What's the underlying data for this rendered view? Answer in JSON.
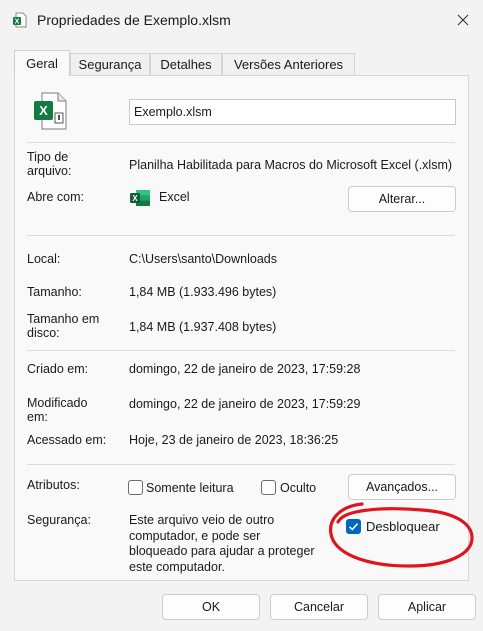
{
  "window": {
    "title": "Propriedades de Exemplo.xlsm",
    "close_icon": "close-icon"
  },
  "tabs": [
    {
      "label": "Geral",
      "active": true
    },
    {
      "label": "Segurança",
      "active": false
    },
    {
      "label": "Detalhes",
      "active": false
    },
    {
      "label": "Versões Anteriores",
      "active": false
    }
  ],
  "general": {
    "file_icon": "excel-macro-file-icon",
    "filename": "Exemplo.xlsm",
    "type_label": "Tipo de\narquivo:",
    "type_value": "Planilha Habilitada para Macros do Microsoft Excel (.xlsm)",
    "opens_with_label": "Abre com:",
    "opens_with_app": "Excel",
    "change_button": "Alterar...",
    "location_label": "Local:",
    "location_value": "C:\\Users\\santo\\Downloads",
    "size_label": "Tamanho:",
    "size_value": "1,84 MB (1.933.496 bytes)",
    "size_on_disk_label": "Tamanho em\ndisco:",
    "size_on_disk_value": "1,84 MB (1.937.408 bytes)",
    "created_label": "Criado em:",
    "created_value": "domingo, 22 de janeiro de 2023, 17:59:28",
    "modified_label": "Modificado\nem:",
    "modified_value": "domingo, 22 de janeiro de 2023, 17:59:29",
    "accessed_label": "Acessado em:",
    "accessed_value": "Hoje, 23 de janeiro de 2023, 18:36:25",
    "attributes_label": "Atributos:",
    "readonly_label": "Somente leitura",
    "readonly_checked": false,
    "hidden_label": "Oculto",
    "hidden_checked": false,
    "advanced_button": "Avançados...",
    "security_label": "Segurança:",
    "security_text": "Este arquivo veio de outro\ncomputador, e pode ser\nbloqueado para ajudar a proteger\neste computador.",
    "unblock_label": "Desbloquear",
    "unblock_checked": true
  },
  "footer": {
    "ok_button": "OK",
    "cancel_button": "Cancelar",
    "apply_button": "Aplicar"
  },
  "colors": {
    "accent": "#0067c0",
    "excel_green": "#107c41",
    "annotation_red": "#e0141e"
  }
}
